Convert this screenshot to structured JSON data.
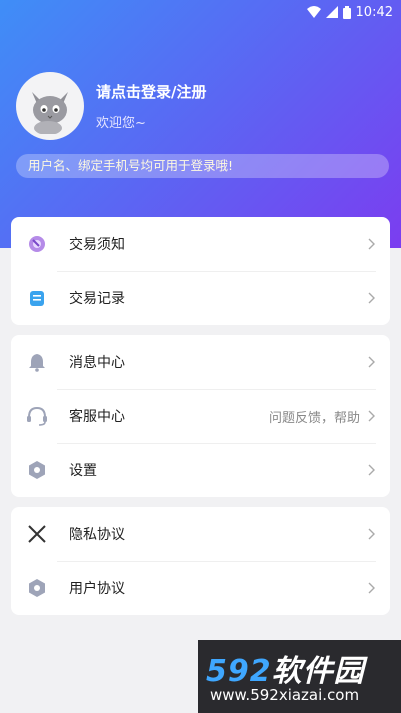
{
  "status": {
    "time": "10:42"
  },
  "profile": {
    "title": "请点击登录/注册",
    "subtitle": "欢迎您~",
    "tip": "用户名、绑定手机号均可用于登录哦!"
  },
  "section1": {
    "items": [
      {
        "label": "交易须知",
        "icon": "trade-notice-icon"
      },
      {
        "label": "交易记录",
        "icon": "trade-record-icon"
      }
    ]
  },
  "section2": {
    "items": [
      {
        "label": "消息中心",
        "icon": "bell-icon"
      },
      {
        "label": "客服中心",
        "icon": "headset-icon",
        "hint": "问题反馈，帮助"
      },
      {
        "label": "设置",
        "icon": "hexagon-settings-icon"
      }
    ]
  },
  "section3": {
    "items": [
      {
        "label": "隐私协议",
        "icon": "close-x-icon"
      },
      {
        "label": "用户协议",
        "icon": "hexagon-agreement-icon"
      }
    ]
  },
  "watermark": {
    "numbers": "592",
    "chinese": "软件园",
    "url": "www.592xiazai.com"
  },
  "colors": {
    "gradient_start": "#3f8ef7",
    "gradient_end": "#7b3df0"
  }
}
